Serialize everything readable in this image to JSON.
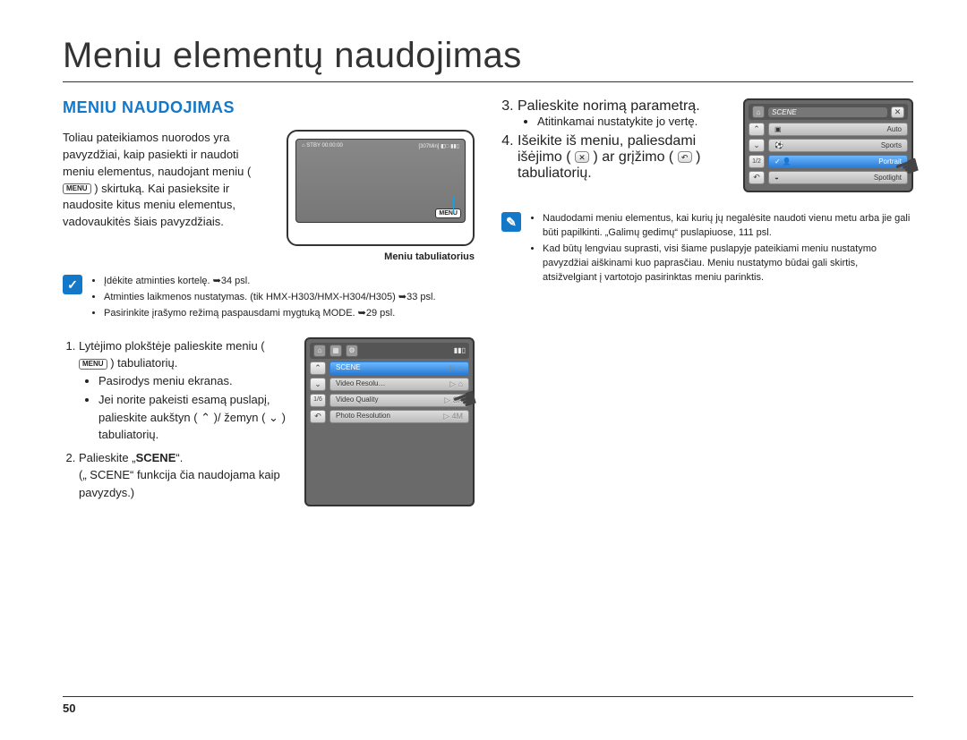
{
  "title": "Meniu elementų naudojimas",
  "section": "MENIU NAUDOJIMAS",
  "intro": "Toliau pateikiamos nuorodos yra pavyzdžiai, kaip pasiekti ir naudoti meniu elementus, naudojant meniu (",
  "intro2": ") skirtuką. Kai pasieksite ir naudosite kitus meniu elementus, vadovaukitės šiais pavyzdžiais.",
  "menu_badge": "MENU",
  "device_caption": "Meniu tabuliatorius",
  "screen_icons": {
    "left": "⌂  STBY  00:00:00",
    "right": "[307Min]  ◧□  ▮▮▯"
  },
  "note_a": [
    "Įdėkite atminties kortelę. ➥34 psl.",
    "Atminties laikmenos nustatymas. (tik HMX-H303/HMX-H304/H305) ➥33 psl.",
    "Pasirinkite įrašymo režimą paspausdami mygtuką MODE. ➥29 psl."
  ],
  "steps_left": {
    "s1": "Lytėjimo plokštėje palieskite meniu (",
    "s1b": ") tabuliatorių.",
    "s1_sub": [
      "Pasirodys meniu ekranas.",
      "Jei norite pakeisti esamą puslapį, palieskite aukštyn ( ⌃ )/ žemyn ( ⌄ ) tabuliatorių."
    ],
    "s2a": "Palieskite „",
    "s2_bold": "SCENE",
    "s2b": "“.",
    "s2_note": "(„ SCENE“ funkcija čia naudojama kaip pavyzdys.)"
  },
  "mini1": {
    "page": "1/6",
    "items": [
      "SCENE",
      "Video Resolu…",
      "Video Quality",
      "Photo Resolution"
    ],
    "badges": [
      "▷ ⌂",
      "▷ ⌂",
      "▷ SF",
      "▷ 4M"
    ]
  },
  "steps_right": {
    "s3": "Palieskite norimą parametrą.",
    "s3_sub": [
      "Atitinkamai nustatykite jo vertę."
    ],
    "s4a": "Išeikite iš meniu, paliesdami išėjimo (",
    "s4_x": "✕",
    "s4b": ") ar grįžimo (",
    "s4_back": "↶",
    "s4c": ") tabuliatorių."
  },
  "mini2": {
    "head": "SCENE",
    "page": "1/2",
    "items": [
      "Auto",
      "Sports",
      "Portrait",
      "Spotlight"
    ],
    "selected": 2
  },
  "note_b": [
    "Naudodami meniu elementus, kai kurių jų negalėsite naudoti vienu metu arba jie gali būti papilkinti. „Galimų gedimų“ puslapiuose, 111 psl.",
    "Kad būtų lengviau suprasti, visi šiame puslapyje pateikiami meniu nustatymo pavyzdžiai aiškinami kuo paprasčiau. Meniu nustatymo būdai gali skirtis, atsižvelgiant į vartotojo pasirinktas meniu parinktis."
  ],
  "page_number": "50"
}
